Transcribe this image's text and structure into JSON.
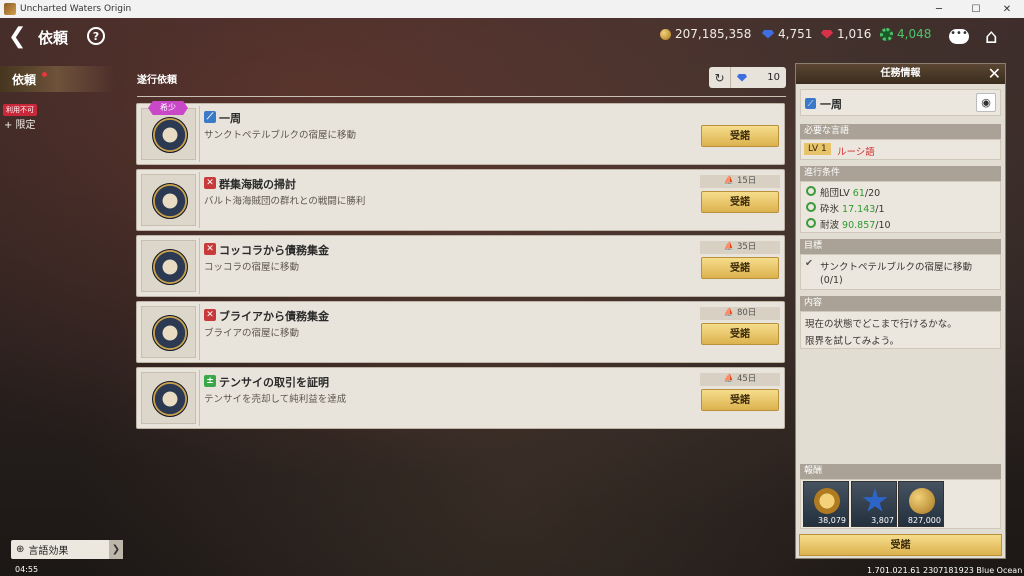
{
  "window": {
    "title": "Uncharted Waters Origin",
    "minimize": "─",
    "maximize": "☐",
    "close": "✕"
  },
  "header": {
    "back": "❮",
    "title": "依頼",
    "help": "?",
    "chat": "•••",
    "home": "⌂",
    "currencies": [
      {
        "icon": "gold-coin-icon",
        "value": "207,185,358",
        "color": "#f0ece6"
      },
      {
        "icon": "blue-gem-icon",
        "value": "4,751",
        "color": "#f0ece6"
      },
      {
        "icon": "red-gem-icon",
        "value": "1,016",
        "color": "#f0ece6"
      },
      {
        "icon": "green-gear-icon",
        "value": "4,048",
        "color": "#4fc56a"
      }
    ]
  },
  "sidebar": {
    "tab": "依頼",
    "badge": "利用不可",
    "limited": "+ 限定"
  },
  "section": {
    "title": "遂行依頼",
    "refresh_icon": "↻",
    "refresh_count": "10"
  },
  "quests": [
    {
      "title": "一周",
      "desc": "サンクトペテルブルクの宿屋に移動",
      "days": "",
      "accept": "受諾",
      "rarity": "希少",
      "type_icon": "navigation-icon",
      "type_color": "#3a7ac8",
      "type_glyph": "⟋"
    },
    {
      "title": "群集海賊の掃討",
      "desc": "バルト海海賊団の群れとの戦闘に勝利",
      "days": "15日",
      "accept": "受諾",
      "type_icon": "battle-icon",
      "type_color": "#c83a3a",
      "type_glyph": "✕"
    },
    {
      "title": "コッコラから債務集金",
      "desc": "コッコラの宿屋に移動",
      "days": "35日",
      "accept": "受諾",
      "type_icon": "battle-icon",
      "type_color": "#c83a3a",
      "type_glyph": "✕"
    },
    {
      "title": "ブライアから債務集金",
      "desc": "ブライアの宿屋に移動",
      "days": "80日",
      "accept": "受諾",
      "type_icon": "battle-icon",
      "type_color": "#c83a3a",
      "type_glyph": "✕"
    },
    {
      "title": "テンサイの取引を証明",
      "desc": "テンサイを売却して純利益を達成",
      "days": "45日",
      "accept": "受諾",
      "type_icon": "trade-icon",
      "type_color": "#3aa84a",
      "type_glyph": "±"
    }
  ],
  "panel": {
    "title": "任務情報",
    "close": "✕",
    "quest_title": "一周",
    "language_header": "必要な言語",
    "lv": "LV 1",
    "language": "ルーシ語",
    "conditions_header": "進行条件",
    "conditions": [
      {
        "label": "船団LV",
        "value": "61",
        "target": "/20"
      },
      {
        "label": "砕氷",
        "value": "17.143",
        "target": "/1"
      },
      {
        "label": "耐波",
        "value": "90.857",
        "target": "/10"
      }
    ],
    "goal_header": "目標",
    "goal": "サンクトペテルブルクの宿屋に移動",
    "goal_progress": "(0/1)",
    "content_header": "内容",
    "content_line1": "現在の状態でどこまで行けるかな。",
    "content_line2": "限界を試してみよう。",
    "reward_header": "報酬",
    "rewards": [
      {
        "icon": "medal-icon",
        "value": "38,079"
      },
      {
        "icon": "blue-star-icon",
        "value": "3,807"
      },
      {
        "icon": "gold-coin-icon",
        "value": "827,000"
      }
    ],
    "accept": "受諾"
  },
  "footer": {
    "lang_effect": "言語効果",
    "arrow": "❯",
    "time": "04:55",
    "version": "1.701.021.61 2307181923 Blue Ocean"
  }
}
